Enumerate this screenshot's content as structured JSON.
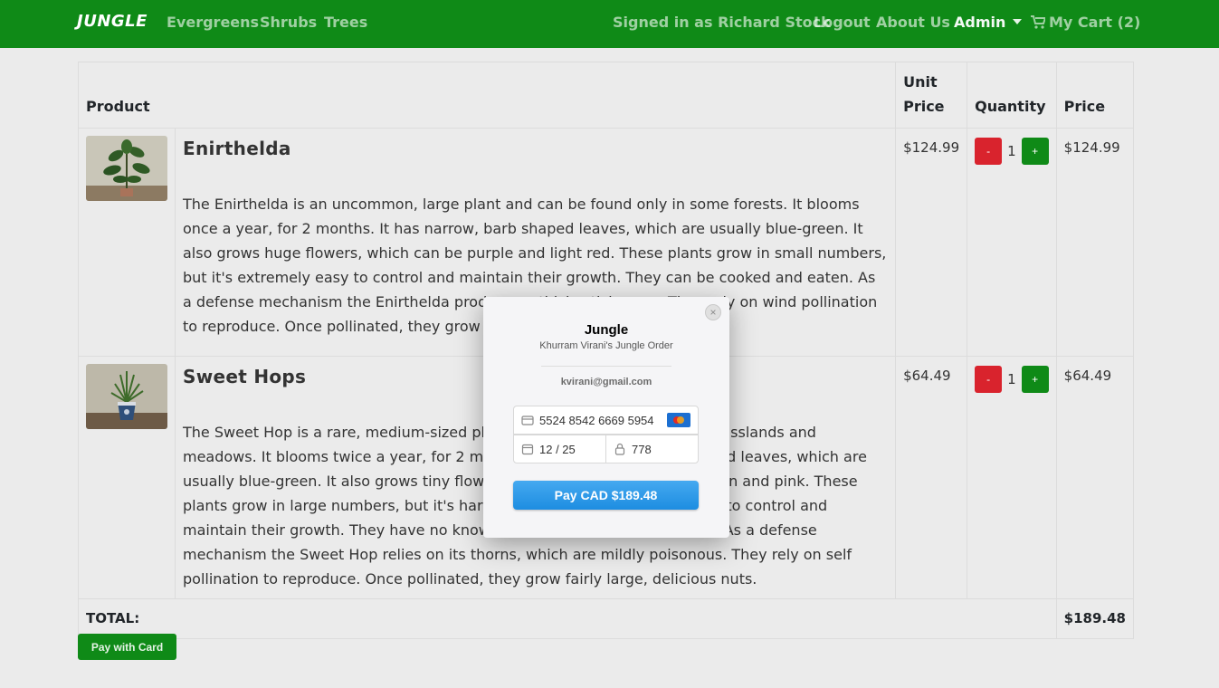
{
  "navbar": {
    "brand": "JUNGLE",
    "links": [
      "Evergreens",
      "Shrubs",
      "Trees"
    ],
    "signed_in": "Signed in as Richard Stock",
    "logout": "Logout",
    "about": "About Us",
    "admin": "Admin",
    "cart": "My Cart (2)"
  },
  "table": {
    "headers": {
      "product": "Product",
      "unit_price": "Unit Price",
      "quantity": "Quantity",
      "price": "Price"
    },
    "rows": [
      {
        "name": "Enirthelda",
        "description": "The Enirthelda is an uncommon, large plant and can be found only in some forests. It blooms once a year, for 2 months. It has narrow, barb shaped leaves, which are usually blue-green. It also grows huge flowers, which can be purple and light red. These plants grow in small numbers, but it's extremely easy to control and maintain their growth. They can be cooked and eaten. As a defense mechanism the Enirthelda produces a thick, sticky wax. They rely on wind pollination to reproduce. Once pollinated, they grow fairly large, inedible nuts.",
        "unit_price": "$124.99",
        "qty": "1",
        "price": "$124.99"
      },
      {
        "name": "Sweet Hops",
        "description": "The Sweet Hop is a rare, medium-sized plant and can be found in some grasslands and meadows. It blooms twice a year, for 2 months. It has thin, diamond shaped leaves, which are usually blue-green. It also grows tiny flowers, which can be dark pink, brown and pink. These plants grow in large numbers, but it's hard, especially without experience, to control and maintain their growth. They have no known uses besides their aesthetics. As a defense mechanism the Sweet Hop relies on its thorns, which are mildly poisonous. They rely on self pollination to reproduce. Once pollinated, they grow fairly large, delicious nuts.",
        "unit_price": "$64.49",
        "qty": "1",
        "price": "$64.49"
      }
    ],
    "minus_label": "-",
    "plus_label": "+",
    "total_label": "TOTAL:",
    "total_value": "$189.48"
  },
  "pay_button": "Pay with Card",
  "checkout": {
    "close": "×",
    "title": "Jungle",
    "subtitle": "Khurram Virani's Jungle Order",
    "email": "kvirani@gmail.com",
    "card_number": "5524 8542 6669 5954",
    "expiry": "12 / 25",
    "cvc": "778",
    "pay_label": "Pay CAD $189.48"
  },
  "colors": {
    "navbar": "#0f8a17",
    "danger": "#d9232d",
    "pay": "#1d8de1"
  }
}
